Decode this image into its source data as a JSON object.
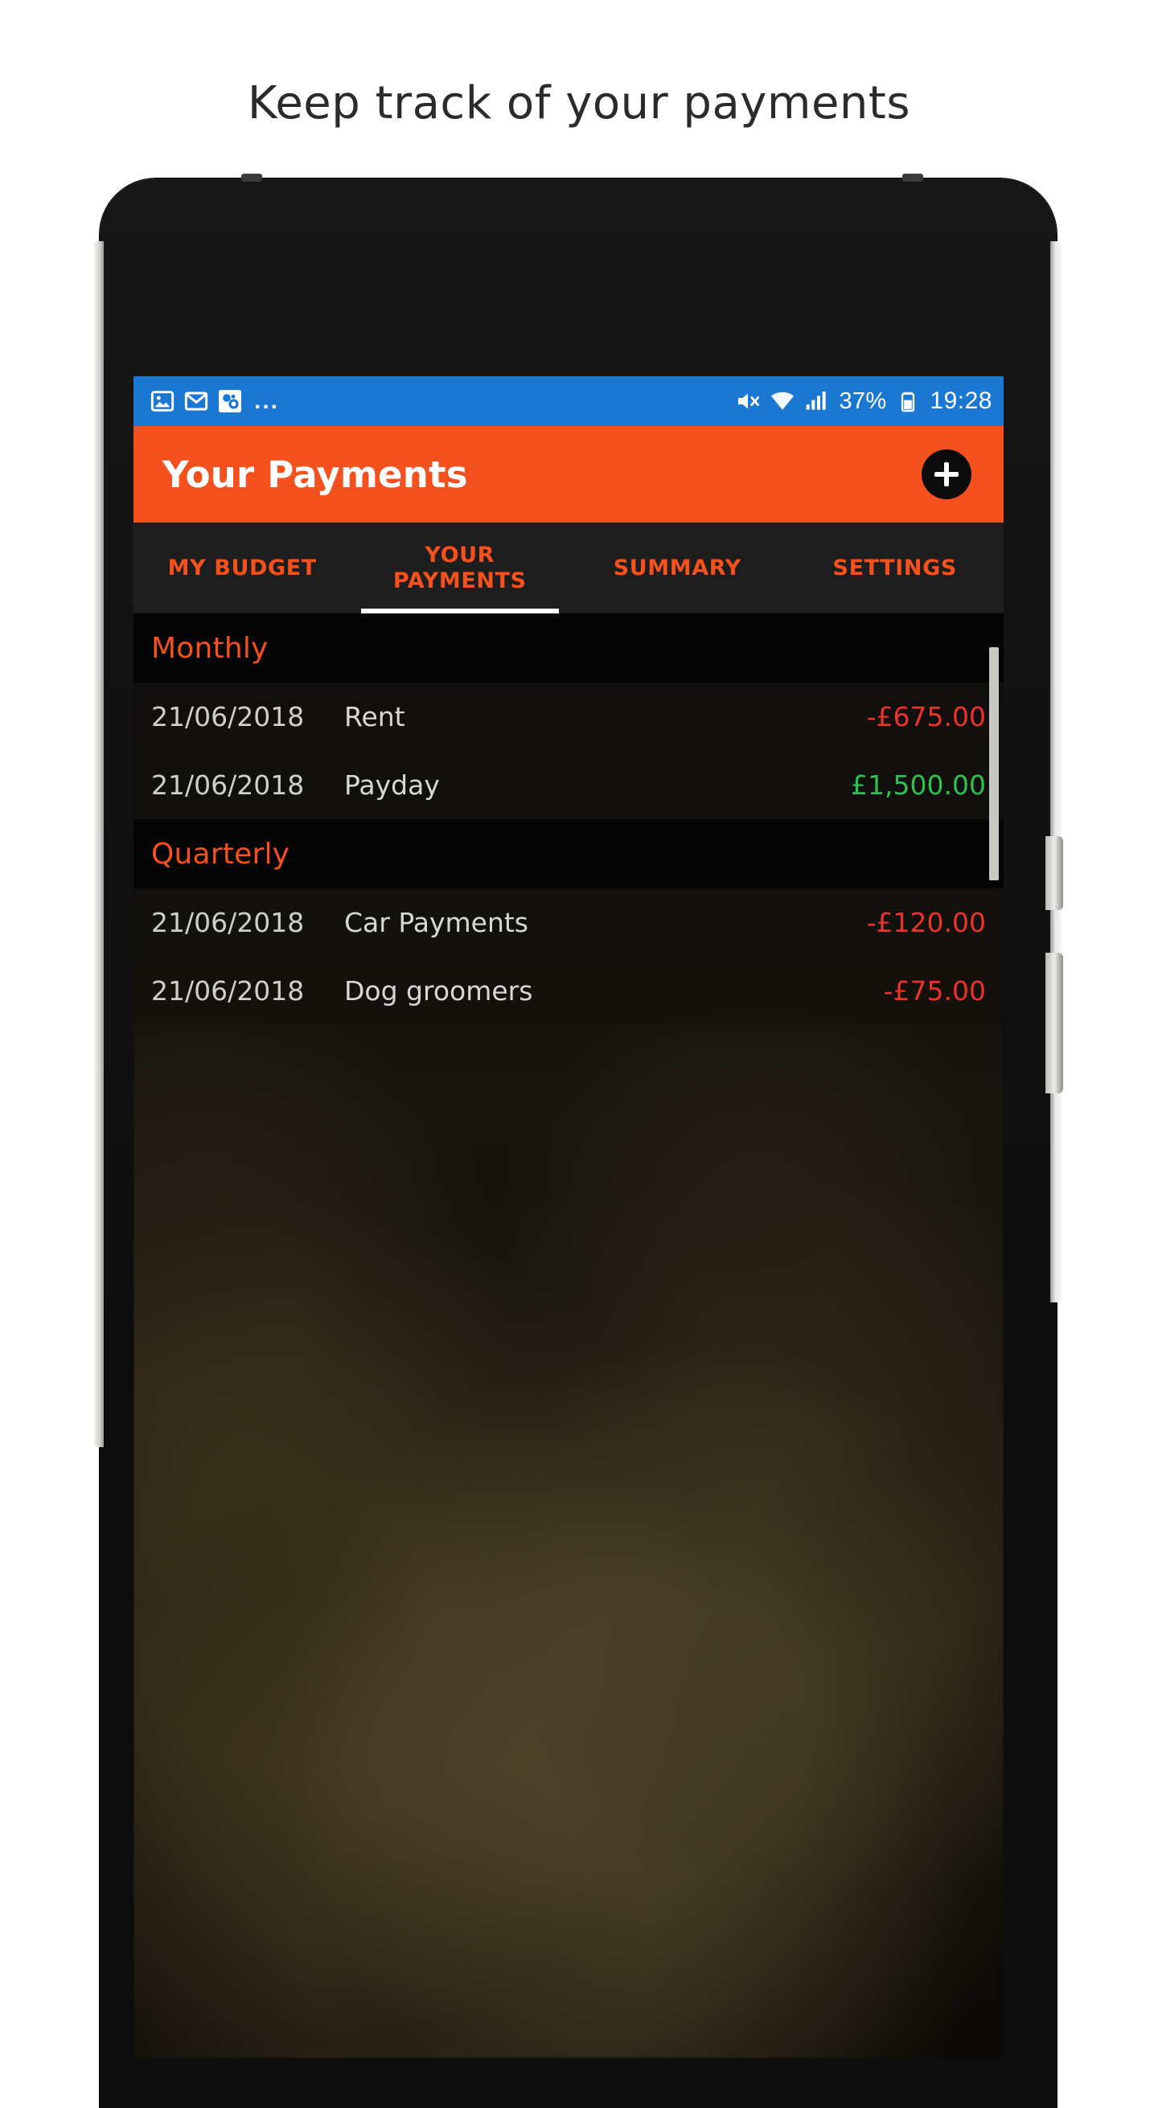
{
  "headline": "Keep track of your payments",
  "colors": {
    "accent_orange": "#f4511e",
    "status_blue": "#1a78d2",
    "negative_red": "#e8342a",
    "positive_green": "#2fc14e",
    "list_bg": "#0b0b0a"
  },
  "status_bar": {
    "left_icons": [
      "photos-icon",
      "gmail-icon",
      "app-icon"
    ],
    "overflow": "...",
    "right_icons": [
      "mute-icon",
      "wifi-icon",
      "signal-icon",
      "battery-icon"
    ],
    "battery_percent": "37%",
    "time": "19:28"
  },
  "app_bar": {
    "title": "Your Payments",
    "add_button": "add-payment-icon"
  },
  "tabs": [
    {
      "label": "MY BUDGET",
      "active": false
    },
    {
      "label": "YOUR\nPAYMENTS",
      "active": true
    },
    {
      "label": "SUMMARY",
      "active": false
    },
    {
      "label": "SETTINGS",
      "active": false
    }
  ],
  "sections": [
    {
      "title": "Monthly",
      "rows": [
        {
          "date": "21/06/2018",
          "name": "Rent",
          "amount": "-£675.00",
          "sign": "negative"
        },
        {
          "date": "21/06/2018",
          "name": "Payday",
          "amount": "£1,500.00",
          "sign": "positive"
        }
      ]
    },
    {
      "title": "Quarterly",
      "rows": [
        {
          "date": "21/06/2018",
          "name": "Car Payments",
          "amount": "-£120.00",
          "sign": "negative"
        },
        {
          "date": "21/06/2018",
          "name": "Dog groomers",
          "amount": "-£75.00",
          "sign": "negative"
        }
      ]
    }
  ]
}
